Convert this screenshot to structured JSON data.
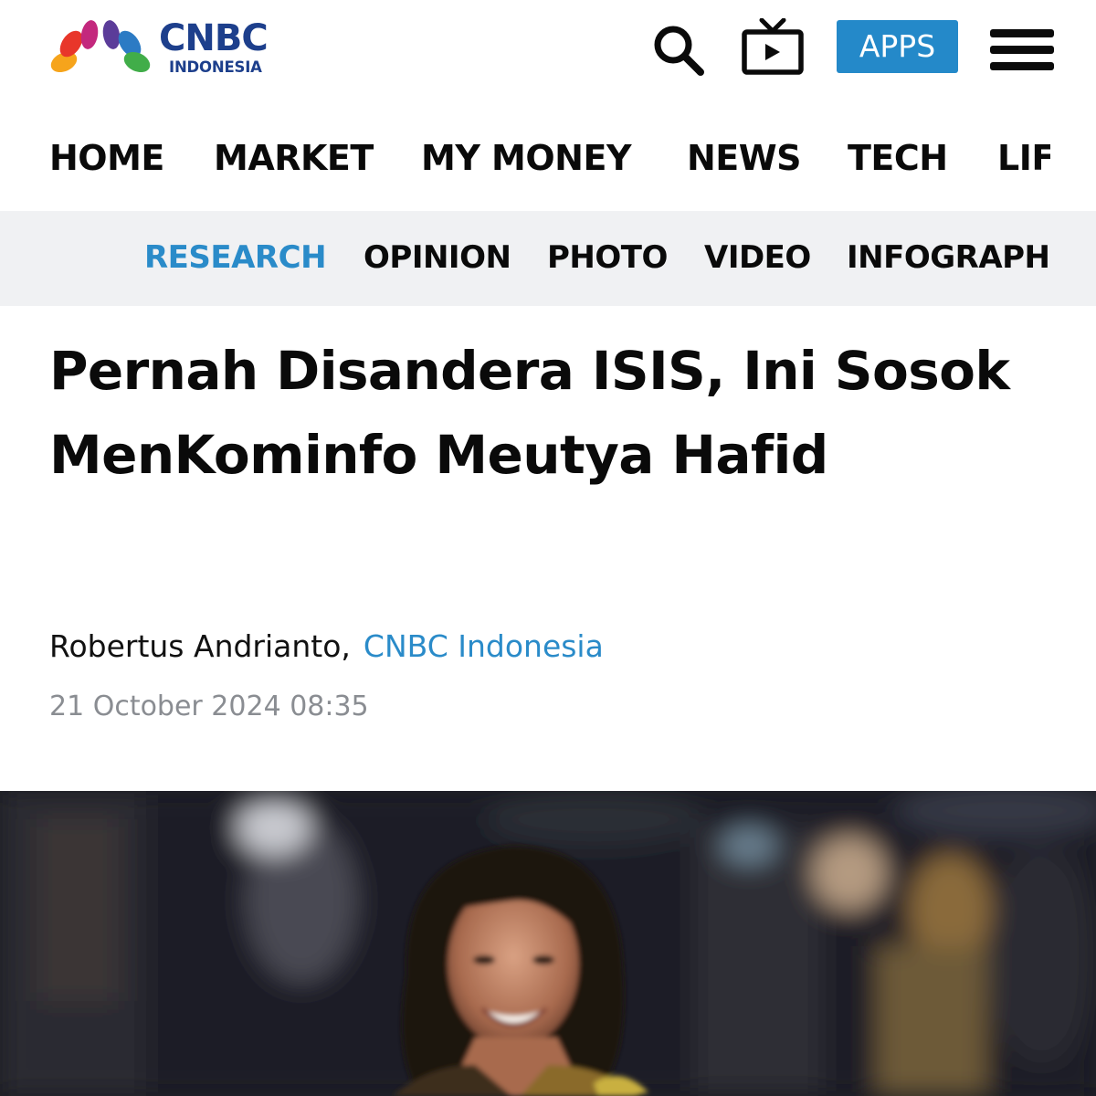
{
  "header": {
    "logo_text": "CNBC",
    "logo_subtext": "INDONESIA",
    "apps_label": "APPS",
    "icons": [
      "search-icon",
      "live-tv-icon",
      "hamburger-menu-icon"
    ],
    "accent_color": "#2489c9"
  },
  "main_nav": {
    "items": [
      {
        "label": "HOME"
      },
      {
        "label": "MARKET"
      },
      {
        "label": "MY MONEY"
      },
      {
        "label": "NEWS"
      },
      {
        "label": "TECH"
      },
      {
        "label": "LIF"
      }
    ]
  },
  "sub_nav": {
    "active_color": "#2a8bc9",
    "items": [
      {
        "label": "RESEARCH",
        "active": true
      },
      {
        "label": "OPINION",
        "active": false
      },
      {
        "label": "PHOTO",
        "active": false
      },
      {
        "label": "VIDEO",
        "active": false
      },
      {
        "label": "INFOGRAPH",
        "active": false
      }
    ]
  },
  "article": {
    "headline": "Pernah Disandera ISIS, Ini Sosok MenKominfo Meutya Hafid",
    "author": "Robertus Andrianto,",
    "source": "CNBC Indonesia",
    "date": "21 October 2024 08:35"
  }
}
